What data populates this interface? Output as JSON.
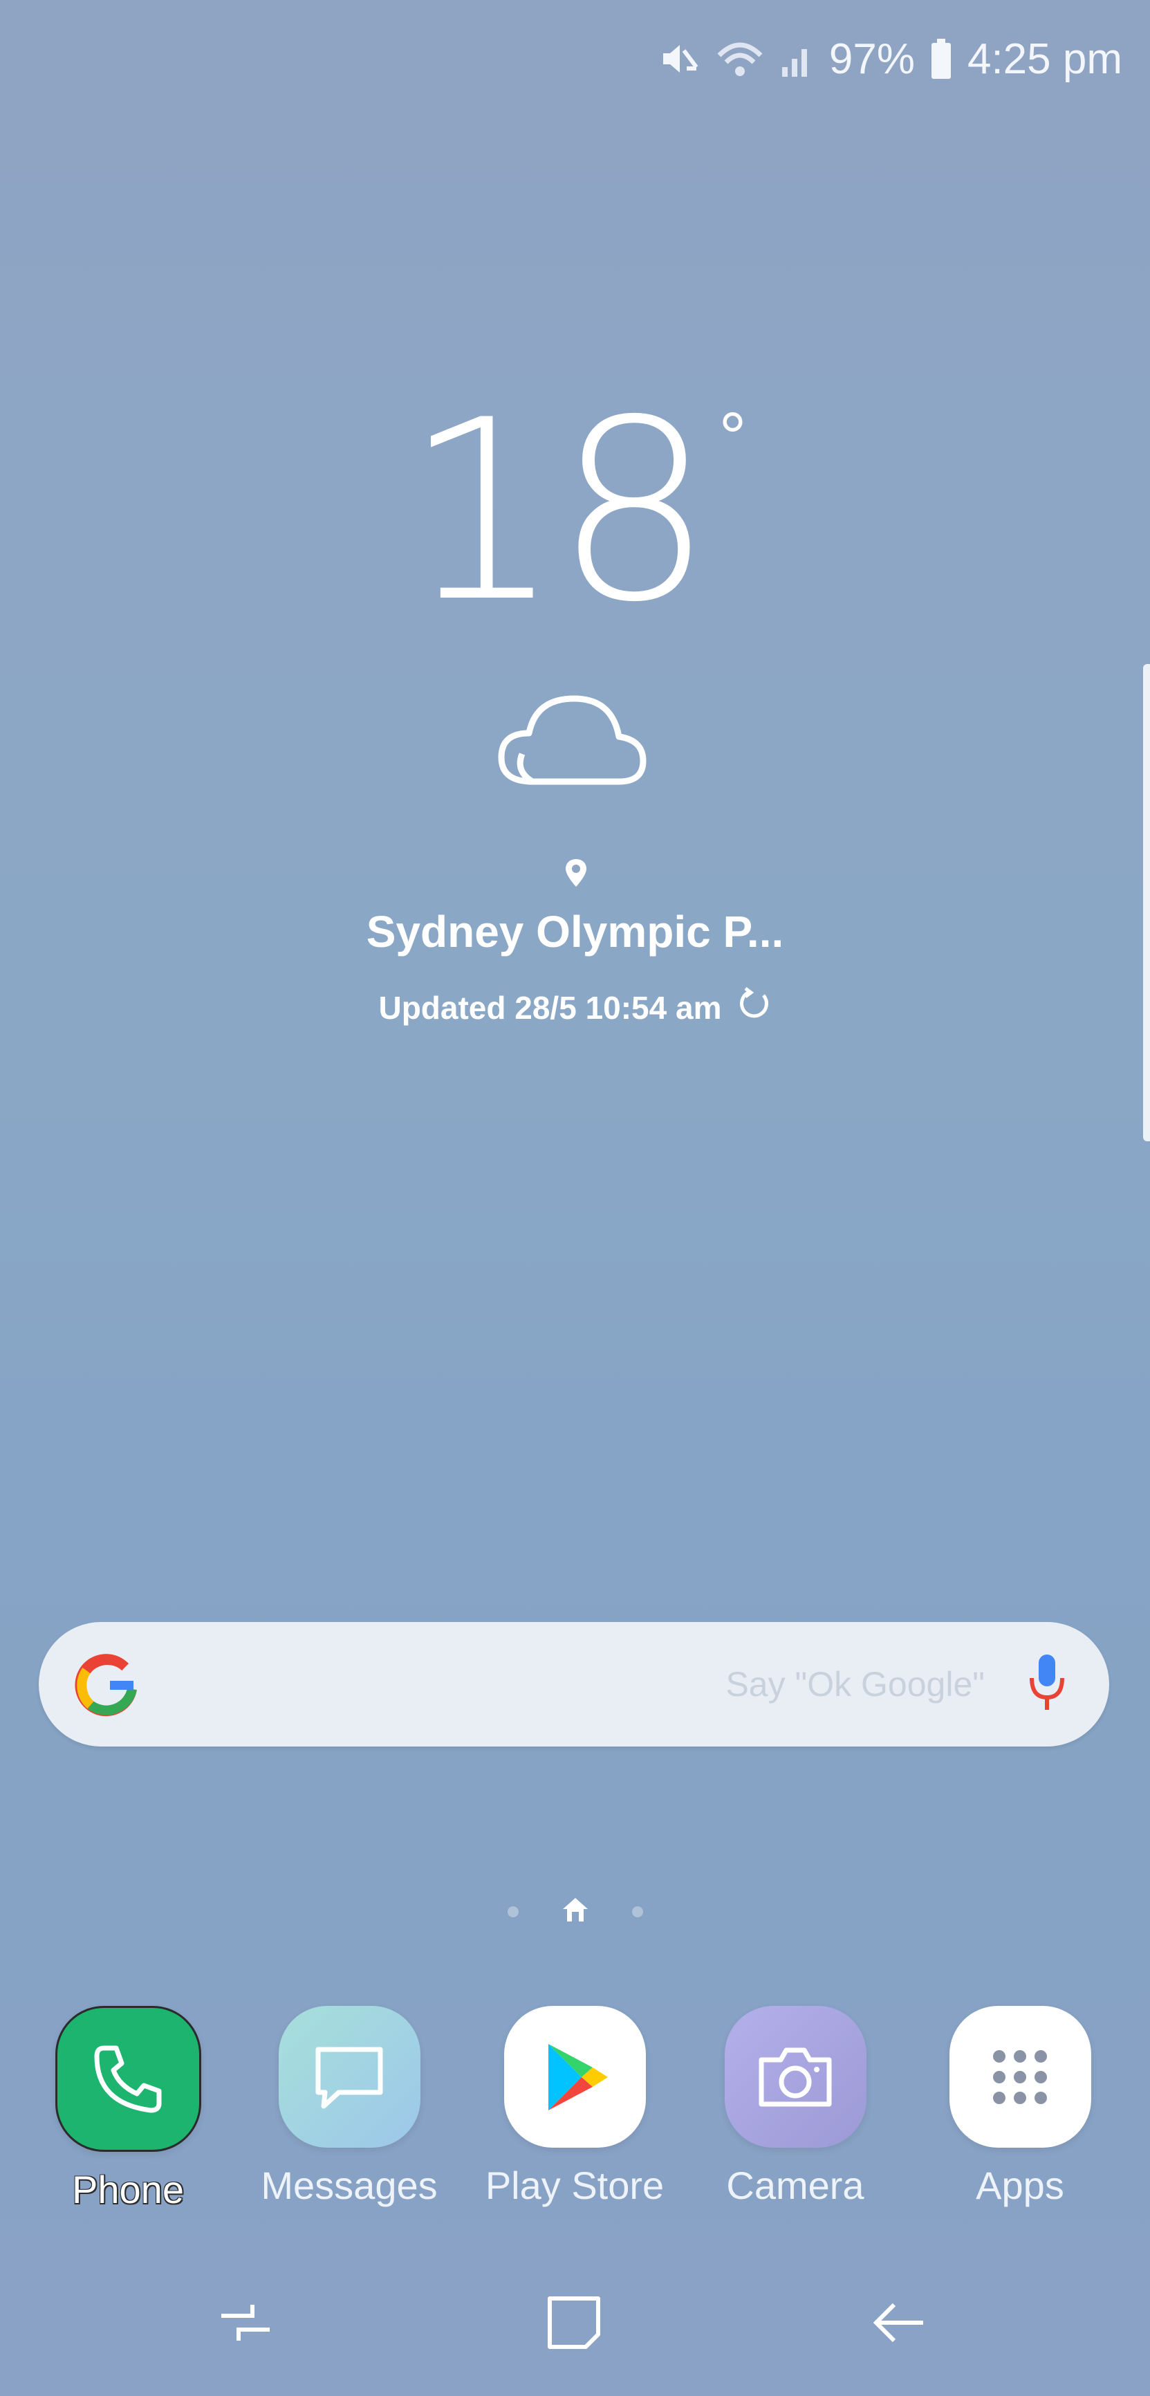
{
  "status_bar": {
    "battery": "97%",
    "time": "4:25 pm",
    "icons": [
      "mute-icon",
      "wifi-icon",
      "signal-icon",
      "battery-icon"
    ]
  },
  "weather": {
    "temperature": "18",
    "degree_symbol": "°",
    "condition_icon": "cloud-icon",
    "location": "Sydney Olympic P...",
    "updated": "Updated 28/5 10:54 am"
  },
  "search": {
    "placeholder": "Say \"Ok Google\"",
    "logo": "google-g-icon",
    "mic_icon": "microphone-icon"
  },
  "dock": {
    "apps": [
      {
        "label": "Phone",
        "icon": "phone-icon",
        "color": "#1db46f"
      },
      {
        "label": "Messages",
        "icon": "messages-icon",
        "color": "#9fd1e3"
      },
      {
        "label": "Play Store",
        "icon": "play-store-icon",
        "color": "#ffffff"
      },
      {
        "label": "Camera",
        "icon": "camera-icon",
        "color": "#a9a6e0"
      },
      {
        "label": "Apps",
        "icon": "apps-grid-icon",
        "color": "#ffffff"
      }
    ]
  },
  "navigation": {
    "buttons": [
      "recent-apps-icon",
      "home-icon",
      "back-icon"
    ]
  },
  "page_indicator": {
    "pages": 3,
    "current": 2
  }
}
